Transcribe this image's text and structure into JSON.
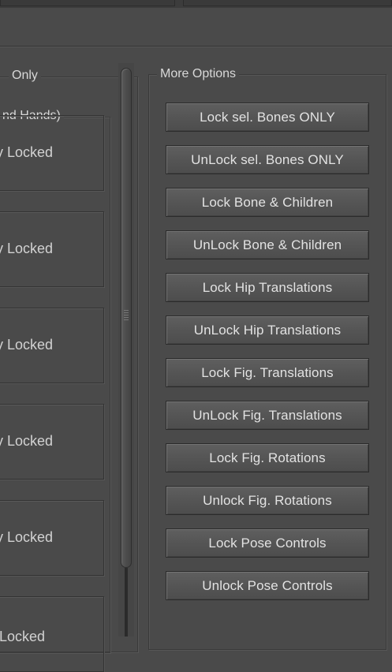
{
  "left_panel": {
    "group_title": "Only",
    "subgroup_title": "nd Hands)",
    "lock_boxes": [
      {
        "label": "ly Locked"
      },
      {
        "label": "ly Locked"
      },
      {
        "label": "ly Locked"
      },
      {
        "label": "ly Locked"
      },
      {
        "label": "ly Locked"
      },
      {
        "label": "Locked"
      }
    ]
  },
  "right_panel": {
    "group_title": "More Options",
    "buttons": [
      {
        "label": "Lock sel. Bones ONLY"
      },
      {
        "label": "UnLock sel. Bones ONLY"
      },
      {
        "label": "Lock Bone & Children"
      },
      {
        "label": "UnLock Bone & Children"
      },
      {
        "label": "Lock Hip Translations"
      },
      {
        "label": "UnLock Hip Translations"
      },
      {
        "label": "Lock Fig. Translations"
      },
      {
        "label": "UnLock Fig. Translations"
      },
      {
        "label": "Lock Fig. Rotations"
      },
      {
        "label": "Unlock Fig. Rotations"
      },
      {
        "label": "Lock Pose Controls"
      },
      {
        "label": "Unlock Pose Controls"
      }
    ]
  },
  "colors": {
    "panel_background": "#4a4a4a",
    "button_face": "#555555",
    "text": "#d4d4d4"
  }
}
